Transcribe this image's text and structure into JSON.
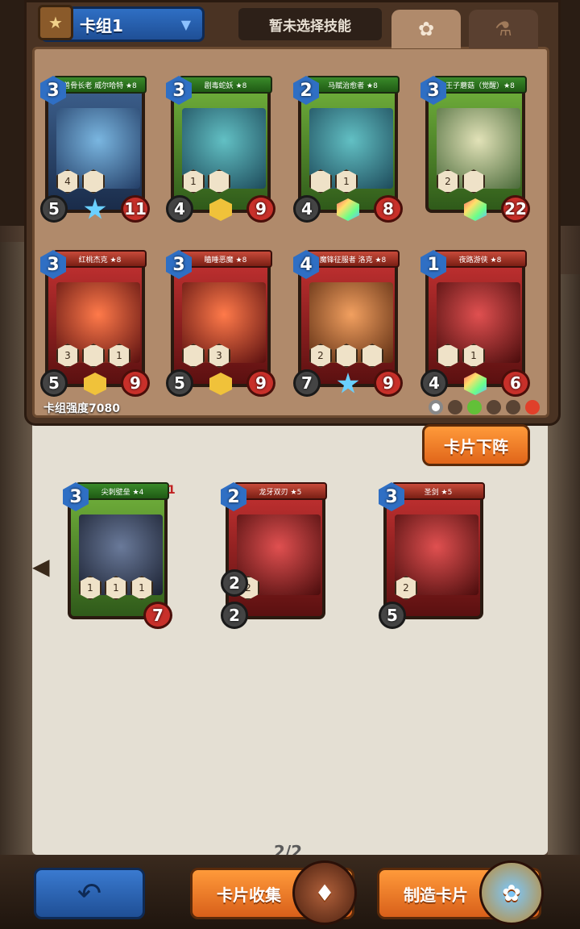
{
  "deck": {
    "name": "卡组1",
    "icon": "book-icon"
  },
  "skill_label": "暂未选择技能",
  "tabs": [
    {
      "icon": "paw-icon",
      "active": true
    },
    {
      "icon": "potion-icon",
      "active": false
    }
  ],
  "deck_cards": [
    {
      "name": "兽骨长老 威尔哈特 ★8",
      "cost": "3",
      "atk": "5",
      "hp": "11",
      "frame": "blue",
      "art": "blue",
      "gem": "star",
      "banner": "green",
      "abilities": [
        "4",
        ""
      ]
    },
    {
      "name": "剧毒蛇妖 ★8",
      "cost": "3",
      "atk": "4",
      "hp": "9",
      "frame": "green",
      "art": "teal",
      "gem": "gold",
      "banner": "green",
      "abilities": [
        "1",
        ""
      ]
    },
    {
      "name": "马赋治愈者 ★8",
      "cost": "2",
      "atk": "4",
      "hp": "8",
      "frame": "green",
      "art": "teal",
      "gem": "rainbow",
      "banner": "green",
      "abilities": [
        "",
        "1"
      ]
    },
    {
      "name": "王子蘑菇（觉醒）★8",
      "cost": "3",
      "atk": "",
      "hp": "22",
      "frame": "green",
      "art": "mush",
      "gem": "rainbow",
      "banner": "green",
      "abilities": [
        "2",
        ""
      ]
    },
    {
      "name": "红桃杰克 ★8",
      "cost": "3",
      "atk": "5",
      "hp": "9",
      "frame": "red",
      "art": "red",
      "gem": "gold",
      "banner": "red",
      "abilities": [
        "3",
        "",
        "1"
      ]
    },
    {
      "name": "瞌睡恶魔 ★8",
      "cost": "3",
      "atk": "5",
      "hp": "9",
      "frame": "red",
      "art": "red",
      "gem": "gold",
      "banner": "red",
      "abilities": [
        "",
        "3"
      ]
    },
    {
      "name": "魔锋征服者 洛克 ★8",
      "cost": "4",
      "atk": "7",
      "hp": "9",
      "frame": "red",
      "art": "orange",
      "gem": "star",
      "banner": "red",
      "abilities": [
        "2",
        "",
        ""
      ]
    },
    {
      "name": "夜路游侠 ★8",
      "cost": "1",
      "atk": "4",
      "hp": "6",
      "frame": "red",
      "art": "claw",
      "gem": "rainbow",
      "banner": "red",
      "abilities": [
        "",
        "1"
      ]
    }
  ],
  "deck_power": "卡组强度7080",
  "filters": [
    "all",
    "neutral",
    "nature",
    "beast",
    "dragon",
    "fire"
  ],
  "remove_label": "卡片下阵",
  "collection_cards": [
    {
      "name": "尖刺壁垒 ★4",
      "cost": "3",
      "atk": "",
      "hp": "7",
      "count": "1",
      "frame": "green",
      "art": "metal",
      "abilities": [
        "1",
        "1",
        "1"
      ]
    },
    {
      "name": "龙牙双刃 ★5",
      "cost": "2",
      "atk": "2",
      "hp": "",
      "extra": "2",
      "frame": "red",
      "art": "claw",
      "abilities": [
        "2"
      ]
    },
    {
      "name": "圣剑 ★5",
      "cost": "3",
      "atk": "5",
      "hp": "",
      "frame": "red",
      "art": "claw",
      "abilities": [
        "2"
      ]
    }
  ],
  "page_indicator": "2/2",
  "buttons": {
    "back_icon": "back-arrow-icon",
    "collection_label": "卡片收集",
    "craft_label": "制造卡片"
  }
}
